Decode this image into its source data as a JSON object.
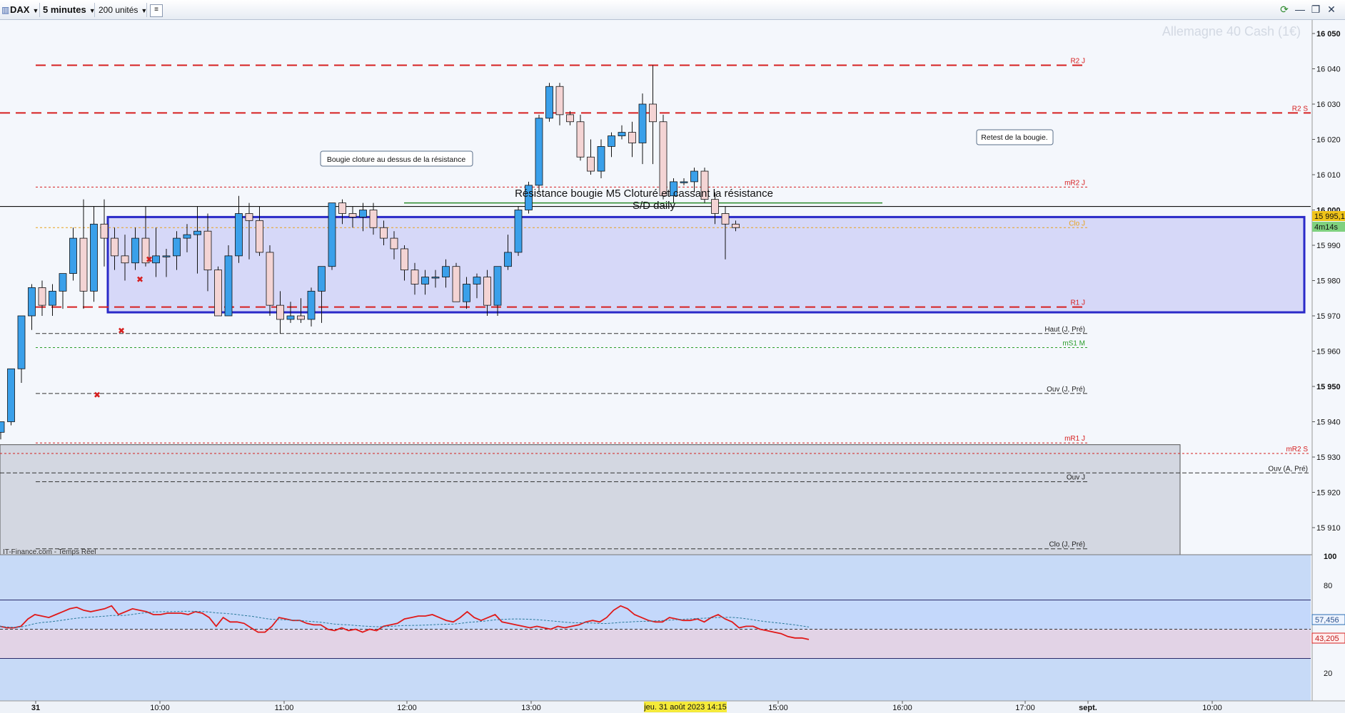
{
  "toolbar": {
    "symbol": "DAX",
    "timeframe": "5 minutes",
    "units": "200 unités"
  },
  "chart": {
    "instrument_title": "Allemagne 40 Cash (1€)",
    "source_label": "IT-Finance.com - Temps Réel",
    "price_ticks": [
      "16 050",
      "16 040",
      "16 030",
      "16 020",
      "16 010",
      "16 000",
      "15 990",
      "15 980",
      "15 970",
      "15 960",
      "15 950",
      "15 940",
      "15 930",
      "15 920",
      "15 910"
    ],
    "price_tick_values": [
      16050,
      16040,
      16030,
      16020,
      16010,
      16000,
      15990,
      15980,
      15970,
      15960,
      15950,
      15940,
      15930,
      15920,
      15910
    ],
    "bold_ticks": [
      16050,
      16000,
      15950
    ],
    "time_labels": [
      {
        "label": "31",
        "x_time": "08:05",
        "bold": true
      },
      {
        "label": "10:00",
        "x_time": "10:00"
      },
      {
        "label": "11:00",
        "x_time": "11:00"
      },
      {
        "label": "12:00",
        "x_time": "12:00"
      },
      {
        "label": "13:00",
        "x_time": "13:00"
      },
      {
        "label": "15:00",
        "x_time": "15:00"
      },
      {
        "label": "16:00",
        "x_time": "16:00"
      },
      {
        "label": "17:00",
        "x_time": "17:00"
      },
      {
        "label": "sept.",
        "x_time": "17:30",
        "bold": true
      },
      {
        "label": "10:00",
        "x_time": "19:00"
      }
    ],
    "cursor_time_label": "jeu. 31 août 2023 14:15",
    "last_price_label": "15 995,1",
    "timer_label": "4m14s",
    "annotations": {
      "bougie_box": "Bougie cloture au dessus de la résistance",
      "retest_box": "Retest de la bougie.",
      "resistance_text_1": "Résistance bougie M5 Cloturé et cassant la résistance",
      "resistance_text_2": "S/D daily"
    },
    "levels": [
      {
        "name": "R2 J",
        "price": 16041,
        "color": "#d62020",
        "style": "long-dash",
        "label": "R2 J"
      },
      {
        "name": "R2 S",
        "price": 16027.5,
        "color": "#d62020",
        "style": "long-dash",
        "label": "R2 S"
      },
      {
        "name": "mR2 J",
        "price": 16006.5,
        "color": "#d62020",
        "style": "dot",
        "label": "mR2 J"
      },
      {
        "name": "Clo J",
        "price": 15995,
        "color": "#e8a21c",
        "style": "dot",
        "label": "Clo J"
      },
      {
        "name": "R1 J",
        "price": 15972.5,
        "color": "#d62020",
        "style": "long-dash",
        "label": "R1 J"
      },
      {
        "name": "Haut (J, Pré)",
        "price": 15965,
        "color": "#333333",
        "style": "dash",
        "label": "Haut (J, Pré)"
      },
      {
        "name": "mS1 M",
        "price": 15961,
        "color": "#2a9d2a",
        "style": "dot",
        "label": "mS1 M"
      },
      {
        "name": "Ouv (J, Pré)",
        "price": 15948,
        "color": "#333333",
        "style": "dash",
        "label": "Ouv (J, Pré)"
      },
      {
        "name": "mR1 J",
        "price": 15934,
        "color": "#d62020",
        "style": "dot",
        "label": "mR1 J"
      },
      {
        "name": "mR2 S",
        "price": 15931,
        "color": "#d62020",
        "style": "dot",
        "label": "mR2 S"
      },
      {
        "name": "Ouv (A, Pré)",
        "price": 15925.5,
        "color": "#333333",
        "style": "dash",
        "label": "Ouv (A, Pré)"
      },
      {
        "name": "Ouv J",
        "price": 15923,
        "color": "#333333",
        "style": "dash",
        "label": "Ouv J"
      },
      {
        "name": "Clo (J, Pré)",
        "price": 15904,
        "color": "#333333",
        "style": "dash",
        "label": "Clo (J, Pré)"
      }
    ],
    "zone": {
      "price_top": 15998,
      "price_bottom": 15971
    },
    "gray_zone": {
      "price_top": 15933.5
    },
    "resistance_line_price": 16002,
    "candles": [
      [
        15928,
        15949,
        15922,
        15922
      ],
      [
        15927,
        15928,
        15912,
        15925
      ],
      [
        15925,
        15925,
        15916,
        15919
      ],
      [
        15919,
        15934,
        15910,
        15937
      ],
      [
        15937,
        15940,
        15935,
        15940
      ],
      [
        15940,
        15955,
        15939,
        15955
      ],
      [
        15955,
        15970,
        15951,
        15970
      ],
      [
        15970,
        15979,
        15966,
        15978
      ],
      [
        15978,
        15980,
        15970,
        15973
      ],
      [
        15973,
        15979,
        15970,
        15977
      ],
      [
        15977,
        15982,
        15972,
        15982
      ],
      [
        15982,
        15995,
        15980,
        15992
      ],
      [
        15992,
        16003,
        15972,
        15977
      ],
      [
        15977,
        16001,
        15974,
        15996
      ],
      [
        15996,
        16003,
        15984,
        15992
      ],
      [
        15992,
        15995,
        15983,
        15987
      ],
      [
        15987,
        15993,
        15980,
        15985
      ],
      [
        15985,
        15995,
        15983,
        15992
      ],
      [
        15992,
        16001,
        15984,
        15985
      ],
      [
        15985,
        15995,
        15981,
        15987
      ],
      [
        15987,
        15989,
        15981,
        15987
      ],
      [
        15987,
        15994,
        15983,
        15992
      ],
      [
        15992,
        15996,
        15988,
        15993
      ],
      [
        15993,
        16001,
        15982,
        15994
      ],
      [
        15994,
        15999,
        15977,
        15983
      ],
      [
        15983,
        15984,
        15970,
        15970
      ],
      [
        15970,
        15990,
        15970,
        15987
      ],
      [
        15987,
        16004,
        15985,
        15999
      ],
      [
        15999,
        16002,
        15986,
        15997
      ],
      [
        15997,
        16001,
        15987,
        15988
      ],
      [
        15988,
        15990,
        15970,
        15973
      ],
      [
        15973,
        15977,
        15965,
        15969
      ],
      [
        15969,
        15974,
        15968,
        15970
      ],
      [
        15970,
        15975,
        15968,
        15969
      ],
      [
        15969,
        15978,
        15967,
        15977
      ],
      [
        15977,
        15980,
        15968,
        15984
      ],
      [
        15984,
        16001,
        15983,
        16002
      ],
      [
        16002,
        16003,
        15996,
        15999
      ],
      [
        15999,
        16001,
        15995,
        15998
      ],
      [
        15998,
        16002,
        15994,
        16000
      ],
      [
        16000,
        16002,
        15993,
        15995
      ],
      [
        15995,
        15997,
        15990,
        15992
      ],
      [
        15992,
        15994,
        15986,
        15989
      ],
      [
        15989,
        15990,
        15980,
        15983
      ],
      [
        15983,
        15985,
        15976,
        15979
      ],
      [
        15979,
        15983,
        15976,
        15981
      ],
      [
        15981,
        15983,
        15978,
        15981
      ],
      [
        15981,
        15986,
        15978,
        15984
      ],
      [
        15984,
        15985,
        15974,
        15974
      ],
      [
        15974,
        15981,
        15972,
        15979
      ],
      [
        15979,
        15982,
        15975,
        15981
      ],
      [
        15981,
        15983,
        15970,
        15973
      ],
      [
        15973,
        15983,
        15970,
        15984
      ],
      [
        15984,
        15993,
        15983,
        15988
      ],
      [
        15988,
        16001,
        15987,
        16000
      ],
      [
        16000,
        16008,
        15999,
        16007
      ],
      [
        16007,
        16027,
        16005,
        16026
      ],
      [
        16026,
        16036,
        16025,
        16035
      ],
      [
        16035,
        16036,
        16024,
        16027
      ],
      [
        16027,
        16028,
        16024,
        16025
      ],
      [
        16025,
        16027,
        16014,
        16015
      ],
      [
        16015,
        16020,
        16010,
        16011
      ],
      [
        16011,
        16020,
        16009,
        16018
      ],
      [
        16018,
        16022,
        16015,
        16021
      ],
      [
        16021,
        16024,
        16020,
        16022
      ],
      [
        16022,
        16025,
        16015,
        16019
      ],
      [
        16019,
        16033,
        16013,
        16030
      ],
      [
        16030,
        16041,
        16013,
        16025
      ],
      [
        16025,
        16027,
        16003,
        16004
      ],
      [
        16004,
        16009,
        16002,
        16008
      ],
      [
        16008,
        16009,
        16007,
        16008
      ],
      [
        16008,
        16012,
        16005,
        16011
      ],
      [
        16011,
        16012,
        16002,
        16003
      ],
      [
        16003,
        16005,
        15996,
        15999
      ],
      [
        15999,
        16001,
        15986,
        15996
      ],
      [
        15996,
        15997,
        15994,
        15995
      ]
    ],
    "candle_start_time": "08:10",
    "rsi": {
      "ticks": [
        "100",
        "80",
        "20"
      ],
      "tick_values": [
        100,
        80,
        20
      ],
      "upper_band": 70,
      "mid_line": 50,
      "lower_band": 30,
      "value_label_ma": "57,456",
      "value_label_rsi": "43,205",
      "rsi_values": [
        52,
        51,
        51,
        52,
        57,
        60,
        59,
        58,
        60,
        62,
        64,
        65,
        63,
        62,
        63,
        64,
        66,
        60,
        62,
        64,
        63,
        62,
        60,
        60,
        61,
        61,
        61,
        60,
        62,
        61,
        58,
        52,
        58,
        55,
        55,
        54,
        51,
        48,
        48,
        52,
        58,
        57,
        56,
        56,
        54,
        53,
        53,
        50,
        49,
        51,
        49,
        50,
        48,
        50,
        49,
        52,
        53,
        54,
        57,
        58,
        59,
        59,
        60,
        58,
        56,
        55,
        58,
        62,
        58,
        56,
        58,
        60,
        55,
        54,
        53,
        52,
        51,
        52,
        51,
        50,
        52,
        51,
        52,
        53,
        55,
        56,
        55,
        58,
        63,
        66,
        64,
        60,
        58,
        56,
        55,
        55,
        58,
        57,
        56,
        56,
        57,
        55,
        58,
        60,
        57,
        55,
        51,
        52,
        52,
        50,
        49,
        48,
        47,
        45,
        44,
        44,
        43
      ]
    }
  }
}
